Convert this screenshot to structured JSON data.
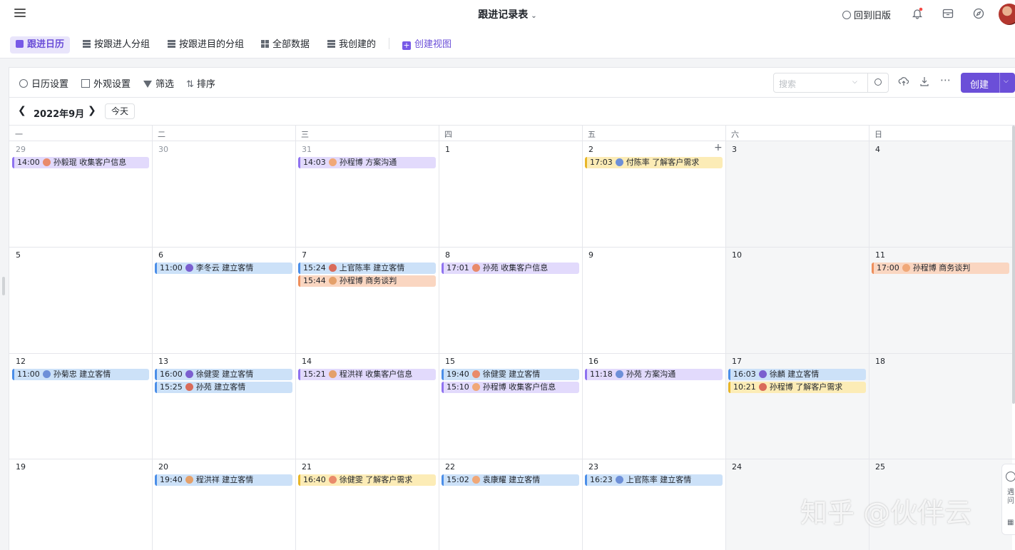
{
  "header": {
    "title": "跟进记录表",
    "old_version": "回到旧版"
  },
  "view_tabs": [
    {
      "label": "跟进日历",
      "active": true
    },
    {
      "label": "按跟进人分组"
    },
    {
      "label": "按跟进目的分组"
    },
    {
      "label": "全部数据"
    },
    {
      "label": "我创建的"
    },
    {
      "label": "创建视图"
    }
  ],
  "toolbar": {
    "calendar_settings": "日历设置",
    "appearance": "外观设置",
    "filter": "筛选",
    "sort": "排序",
    "search_placeholder": "搜索",
    "create": "创建"
  },
  "month_nav": {
    "month_label": "2022年9月",
    "today": "今天"
  },
  "weekdays": [
    "一",
    "二",
    "三",
    "四",
    "五",
    "六",
    "日"
  ],
  "weeks": [
    [
      "29",
      "30",
      "31",
      "1",
      "2",
      "3",
      "4"
    ],
    [
      "5",
      "6",
      "7",
      "8",
      "9",
      "10",
      "11"
    ],
    [
      "12",
      "13",
      "14",
      "15",
      "16",
      "17",
      "18"
    ],
    [
      "19",
      "20",
      "21",
      "22",
      "23",
      "24",
      "25"
    ]
  ],
  "events": [
    {
      "time": "14:00",
      "text": "孙毅琨 收集客户信息",
      "color": "purple"
    },
    {
      "time": "14:03",
      "text": "孙程博 方案沟通",
      "color": "purple"
    },
    {
      "time": "17:03",
      "text": "付陈率 了解客户需求",
      "color": "yellow"
    },
    {
      "time": "11:00",
      "text": "李冬云 建立客情",
      "color": "blue"
    },
    {
      "time": "15:24",
      "text": "上官陈率 建立客情",
      "color": "blue"
    },
    {
      "time": "15:44",
      "text": "孙程博 商务谈判",
      "color": "orange"
    },
    {
      "time": "17:01",
      "text": "孙苑 收集客户信息",
      "color": "purple"
    },
    {
      "time": "17:00",
      "text": "孙程博 商务谈判",
      "color": "orange"
    },
    {
      "time": "11:00",
      "text": "孙菊忠 建立客情",
      "color": "blue"
    },
    {
      "time": "16:00",
      "text": "徐健雯 建立客情",
      "color": "blue"
    },
    {
      "time": "15:25",
      "text": "孙苑 建立客情",
      "color": "blue"
    },
    {
      "time": "15:21",
      "text": "程洪祥 收集客户信息",
      "color": "purple"
    },
    {
      "time": "19:40",
      "text": "徐健雯 建立客情",
      "color": "blue"
    },
    {
      "time": "15:10",
      "text": "孙程博 收集客户信息",
      "color": "purple"
    },
    {
      "time": "11:18",
      "text": "孙苑 方案沟通",
      "color": "purple"
    },
    {
      "time": "16:03",
      "text": "徐麟 建立客情",
      "color": "blue"
    },
    {
      "time": "10:21",
      "text": "孙程博 了解客户需求",
      "color": "yellow"
    },
    {
      "time": "19:40",
      "text": "程洪祥 建立客情",
      "color": "blue"
    },
    {
      "time": "16:40",
      "text": "徐健雯 了解客户需求",
      "color": "yellow"
    },
    {
      "time": "15:02",
      "text": "袁康耀 建立客情",
      "color": "blue"
    },
    {
      "time": "16:23",
      "text": "上官陈率 建立客情",
      "color": "blue"
    }
  ],
  "side_help": {
    "line1": "遇",
    "line2": "问"
  },
  "watermark": "知乎 @伙伴云",
  "colors": {
    "accent": "#6b4fd8",
    "purple_bg": "#e2dafc",
    "blue_bg": "#cce1f8",
    "yellow_bg": "#fcecb6",
    "orange_bg": "#fad6c1"
  }
}
